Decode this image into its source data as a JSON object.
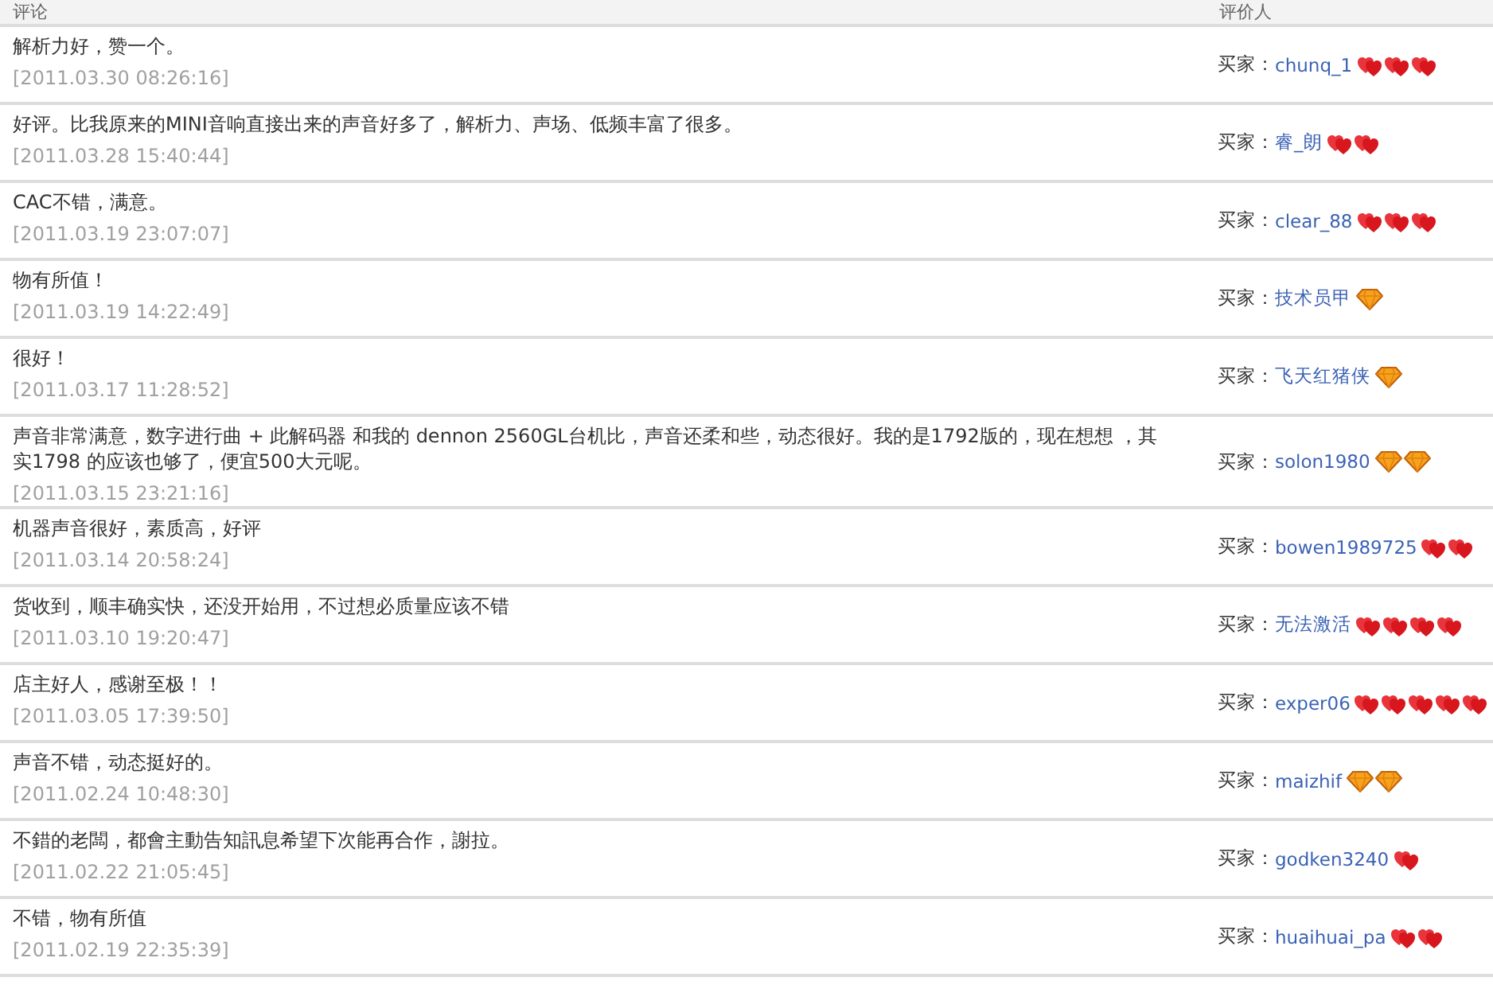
{
  "table": {
    "columns": [
      "评论",
      "评价人"
    ],
    "rows": [
      {
        "comment": "解析力好，赞一个。",
        "date": "[2011.03.30 08:26:16]",
        "buyer_label": "买家：",
        "buyer": "chunq_1",
        "badges": [
          {
            "kind": "heart"
          },
          {
            "kind": "heart"
          },
          {
            "kind": "heart"
          }
        ]
      },
      {
        "comment": "好评。比我原来的MINI音响直接出来的声音好多了，解析力、声场、低频丰富了很多。",
        "date": "[2011.03.28 15:40:44]",
        "buyer_label": "买家：",
        "buyer": "睿_朗",
        "badges": [
          {
            "kind": "heart"
          },
          {
            "kind": "heart"
          }
        ]
      },
      {
        "comment": "CAC不错，满意。",
        "date": "[2011.03.19 23:07:07]",
        "buyer_label": "买家：",
        "buyer": "clear_88",
        "badges": [
          {
            "kind": "heart"
          },
          {
            "kind": "heart"
          },
          {
            "kind": "heart"
          }
        ]
      },
      {
        "comment": "物有所值！",
        "date": "[2011.03.19 14:22:49]",
        "buyer_label": "买家：",
        "buyer": "技术员甲",
        "badges": [
          {
            "kind": "diamond"
          }
        ]
      },
      {
        "comment": "很好！",
        "date": "[2011.03.17 11:28:52]",
        "buyer_label": "买家：",
        "buyer": "飞天红猪侠",
        "badges": [
          {
            "kind": "diamond"
          }
        ]
      },
      {
        "comment": "声音非常满意，数字进行曲 + 此解码器 和我的 dennon 2560GL台机比，声音还柔和些，动态很好。我的是1792版的，现在想想 ，其实1798 的应该也够了，便宜500大元呢。",
        "date": "[2011.03.15 23:21:16]",
        "buyer_label": "买家：",
        "buyer": "solon1980",
        "badges": [
          {
            "kind": "diamond"
          },
          {
            "kind": "diamond"
          }
        ]
      },
      {
        "comment": "机器声音很好，素质高，好评",
        "date": "[2011.03.14 20:58:24]",
        "buyer_label": "买家：",
        "buyer": "bowen1989725",
        "badges": [
          {
            "kind": "heart"
          },
          {
            "kind": "heart"
          }
        ]
      },
      {
        "comment": "货收到，顺丰确实快，还没开始用，不过想必质量应该不错",
        "date": "[2011.03.10 19:20:47]",
        "buyer_label": "买家：",
        "buyer": "无法激活",
        "badges": [
          {
            "kind": "heart"
          },
          {
            "kind": "heart"
          },
          {
            "kind": "heart"
          },
          {
            "kind": "heart"
          }
        ]
      },
      {
        "comment": "店主好人，感谢至极！！",
        "date": "[2011.03.05 17:39:50]",
        "buyer_label": "买家：",
        "buyer": "exper06",
        "badges": [
          {
            "kind": "heart"
          },
          {
            "kind": "heart"
          },
          {
            "kind": "heart"
          },
          {
            "kind": "heart"
          },
          {
            "kind": "heart"
          }
        ]
      },
      {
        "comment": "声音不错，动态挺好的。",
        "date": "[2011.02.24 10:48:30]",
        "buyer_label": "买家：",
        "buyer": "maizhif",
        "badges": [
          {
            "kind": "diamond"
          },
          {
            "kind": "diamond"
          }
        ]
      },
      {
        "comment": "不錯的老闆，都會主動告知訊息希望下次能再合作，謝拉。",
        "date": "[2011.02.22 21:05:45]",
        "buyer_label": "买家：",
        "buyer": "godken3240",
        "badges": [
          {
            "kind": "heart"
          }
        ]
      },
      {
        "comment": "不错，物有所值",
        "date": "[2011.02.19 22:35:39]",
        "buyer_label": "买家：",
        "buyer": "huaihuai_pa",
        "badges": [
          {
            "kind": "heart"
          },
          {
            "kind": "heart"
          }
        ]
      }
    ]
  }
}
